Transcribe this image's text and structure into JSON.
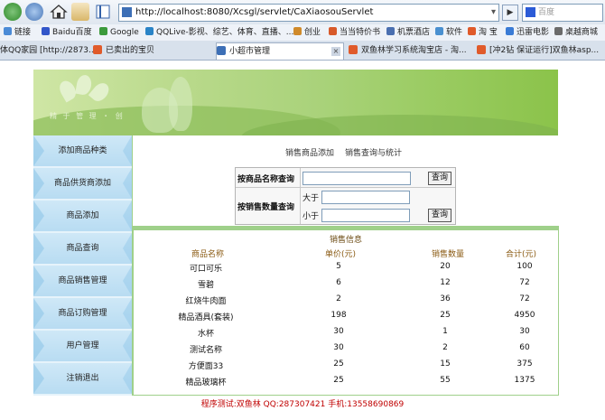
{
  "browser": {
    "url": "http://localhost:8080/Xcsgl/servlet/CaXiaosouServlet",
    "search_placeholder": "百度",
    "bookmarks": [
      "链接",
      "Baidu百度",
      "Google",
      "QQLive-影视、综艺、体育、直播、...",
      "创业",
      "当当特价书",
      "机票酒店",
      "软件",
      "淘 宝",
      "迅雷电影",
      "桌越商城"
    ],
    "tabs": [
      {
        "label": "体QQ家园 [http://2873..."
      },
      {
        "label": "已卖出的宝贝"
      },
      {
        "label": "小超市管理"
      },
      {
        "label": "双鱼林学习系统淘宝店 - 淘..."
      },
      {
        "label": "[冲2钻 保证运行]双鱼林asp..."
      }
    ]
  },
  "banner": {
    "logo_text": "精 于 管 理 ・ 创"
  },
  "sidebar": {
    "items": [
      {
        "label": "添加商品种类"
      },
      {
        "label": "商品供货商添加"
      },
      {
        "label": "商品添加"
      },
      {
        "label": "商品查询"
      },
      {
        "label": "商品销售管理"
      },
      {
        "label": "商品订购管理"
      },
      {
        "label": "用户管理"
      },
      {
        "label": "注销退出"
      }
    ]
  },
  "topnav": {
    "add": "销售商品添加",
    "stats": "销售查询与统计"
  },
  "query": {
    "by_name_label": "按商品名称查询",
    "by_qty_label": "按销售数量查询",
    "gt_label": "大于",
    "lt_label": "小于",
    "btn": "查询"
  },
  "sales": {
    "title": "销售信息",
    "headers": [
      "商品名称",
      "单价(元)",
      "销售数量",
      "合计(元)"
    ],
    "rows": [
      [
        "可口可乐",
        "5",
        "20",
        "100"
      ],
      [
        "雪碧",
        "6",
        "12",
        "72"
      ],
      [
        "红烧牛肉面",
        "2",
        "36",
        "72"
      ],
      [
        "精品酒具(套装)",
        "198",
        "25",
        "4950"
      ],
      [
        "水杯",
        "30",
        "1",
        "30"
      ],
      [
        "测试名称",
        "30",
        "2",
        "60"
      ],
      [
        "方便面33",
        "25",
        "15",
        "375"
      ],
      [
        "精品玻璃杯",
        "25",
        "55",
        "1375"
      ]
    ]
  },
  "footer": "程序测试:双鱼林  QQ:287307421  手机:13558690869"
}
